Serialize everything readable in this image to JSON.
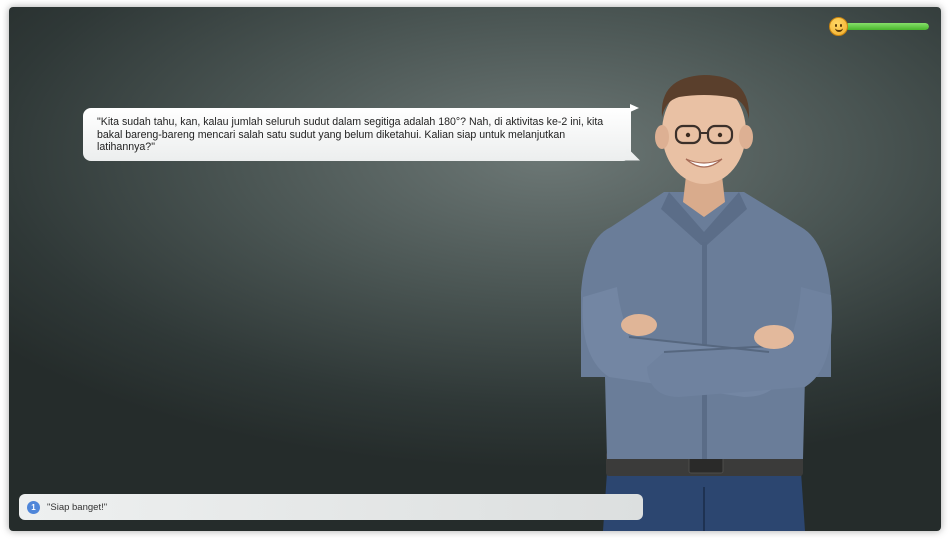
{
  "mood": {
    "level": 1.0,
    "icon": "smiley-face-icon",
    "accent": "#4cb82f"
  },
  "dialogue": {
    "text": "\"Kita sudah tahu, kan, kalau jumlah seluruh sudut dalam segitiga adalah 180°? Nah, di aktivitas ke-2 ini, kita bakal bareng-bareng mencari salah satu sudut yang belum diketahui. Kalian siap untuk melanjutkan latihannya?\""
  },
  "answers": [
    {
      "number": "1",
      "text": "\"Siap banget!\""
    }
  ],
  "colors": {
    "background": "#3d4846",
    "bubble": "#f2f3f3",
    "badge": "#4f86d9"
  }
}
